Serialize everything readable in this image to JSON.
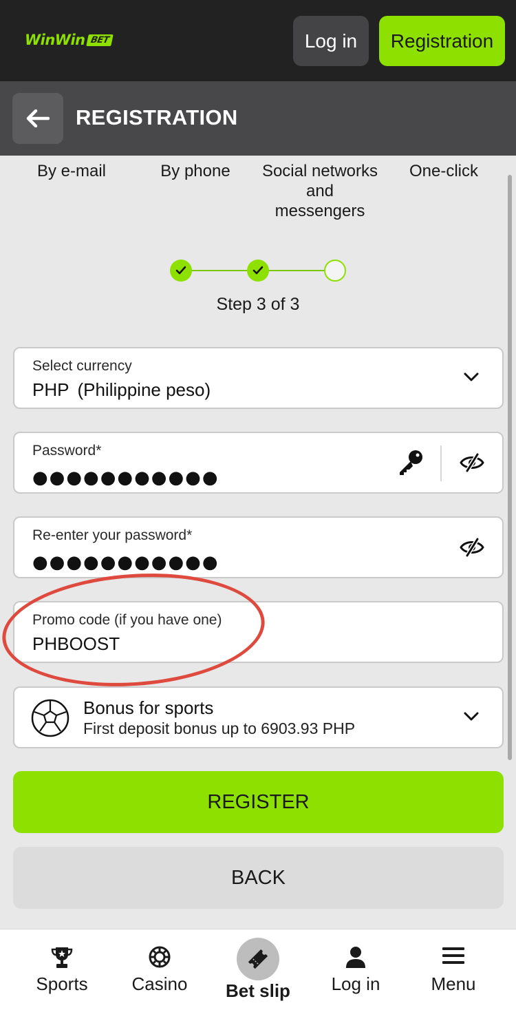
{
  "header": {
    "logo_text": "WinWin",
    "logo_badge": "BET",
    "login_label": "Log in",
    "registration_label": "Registration"
  },
  "subheader": {
    "title": "REGISTRATION",
    "back_icon": "arrow-left-icon"
  },
  "tabs": [
    {
      "label": "By e-mail"
    },
    {
      "label": "By phone"
    },
    {
      "label": "Social networks and messengers"
    },
    {
      "label": "One-click"
    }
  ],
  "stepper": {
    "current": 3,
    "total": 3,
    "completed": 2,
    "label": "Step 3 of 3"
  },
  "form": {
    "currency": {
      "label": "Select currency",
      "code": "PHP",
      "name": "(Philippine peso)"
    },
    "password": {
      "label": "Password*",
      "masked_value": "●●●●●●●●●●●"
    },
    "confirm_password": {
      "label": "Re-enter your password*",
      "masked_value": "●●●●●●●●●●●"
    },
    "promo": {
      "label": "Promo code (if you have one)",
      "value": "PHBOOST"
    },
    "bonus": {
      "title": "Bonus for sports",
      "subtitle": "First deposit bonus up to 6903.93 PHP",
      "icon": "soccer-ball-icon"
    }
  },
  "actions": {
    "register_label": "REGISTER",
    "back_label": "BACK"
  },
  "bottom_nav": [
    {
      "label": "Sports",
      "icon": "trophy-icon"
    },
    {
      "label": "Casino",
      "icon": "casino-chip-icon"
    },
    {
      "label": "Bet slip",
      "icon": "ticket-icon",
      "active": true
    },
    {
      "label": "Log in",
      "icon": "user-icon"
    },
    {
      "label": "Menu",
      "icon": "menu-icon"
    }
  ],
  "colors": {
    "accent": "#8ee000",
    "topbar": "#222222",
    "subheader": "#48484a",
    "annotation": "#de4a3e"
  }
}
